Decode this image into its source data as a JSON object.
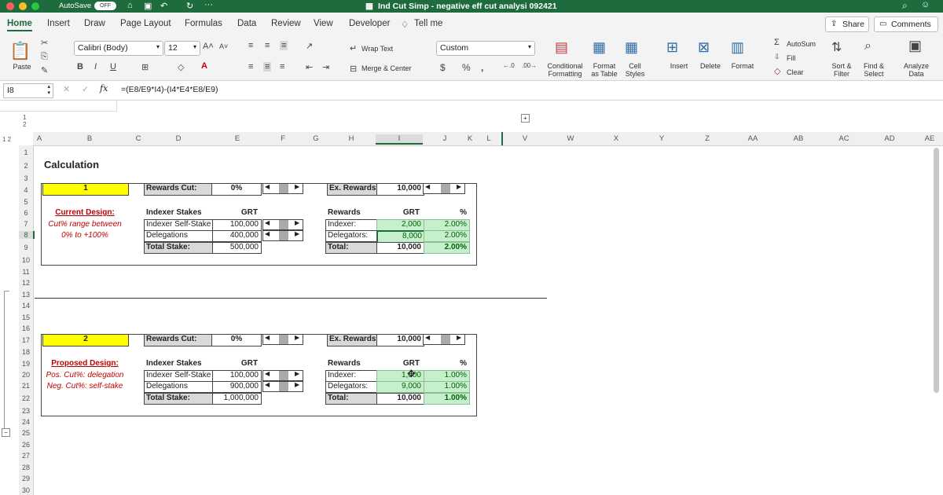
{
  "titlebar": {
    "autosave_label": "AutoSave",
    "autosave_state": "OFF",
    "doc_title": "Ind Cut Simp - negative eff cut analysi 092421"
  },
  "tabs": [
    "Home",
    "Insert",
    "Draw",
    "Page Layout",
    "Formulas",
    "Data",
    "Review",
    "View",
    "Developer"
  ],
  "tell_me": "Tell me",
  "share": "Share",
  "comments": "Comments",
  "ribbon": {
    "paste": "Paste",
    "font_name": "Calibri (Body)",
    "font_size": "12",
    "wrap_text": "Wrap Text",
    "merge_center": "Merge & Center",
    "number_format": "Custom",
    "conditional_formatting": "Conditional Formatting",
    "format_as_table": "Format as Table",
    "cell_styles": "Cell Styles",
    "insert": "Insert",
    "delete": "Delete",
    "format": "Format",
    "autosum": "AutoSum",
    "fill": "Fill",
    "clear": "Clear",
    "sort_filter": "Sort & Filter",
    "find_select": "Find & Select",
    "analyze_data": "Analyze Data"
  },
  "formula_bar": {
    "name_box": "I8",
    "fx": "fx",
    "formula": "=(E8/E9*I4)-(I4*E4*E8/E9)"
  },
  "columns": [
    "A",
    "B",
    "C",
    "D",
    "E",
    "F",
    "G",
    "H",
    "I",
    "J",
    "K",
    "L",
    "V",
    "W",
    "X",
    "Y",
    "Z",
    "AA",
    "AB",
    "AC",
    "AD",
    "AE"
  ],
  "rows": [
    "1",
    "2",
    "3",
    "4",
    "5",
    "6",
    "7",
    "8",
    "9",
    "10",
    "11",
    "12",
    "13",
    "14",
    "15",
    "16",
    "17",
    "18",
    "19",
    "20",
    "21",
    "22",
    "23",
    "24",
    "25",
    "26",
    "27",
    "28",
    "29",
    "30"
  ],
  "sheet": {
    "heading": "Calculation",
    "block1": {
      "id": "1",
      "rewards_cut_label": "Rewards Cut:",
      "rewards_cut_value": "0%",
      "ex_rewards_label": "Ex. Rewards:",
      "ex_rewards_value": "10,000",
      "design_title": "Current Design:",
      "design_line1": "Cut% range between",
      "design_line2": "0% to +100%",
      "stakes_header": "Indexer Stakes",
      "grt_header": "GRT",
      "self_stake_label": "Indexer Self-Stake",
      "self_stake_value": "100,000",
      "delegations_label": "Delegations",
      "delegations_value": "400,000",
      "total_stake_label": "Total Stake:",
      "total_stake_value": "500,000",
      "rewards_header": "Rewards",
      "rewards_grt_header": "GRT",
      "pct_header": "%",
      "indexer_label": "Indexer:",
      "indexer_grt": "2,000",
      "indexer_pct": "2.00%",
      "delegators_label": "Delegators:",
      "delegators_grt": "8,000",
      "delegators_pct": "2.00%",
      "total_label": "Total:",
      "total_grt": "10,000",
      "total_pct": "2.00%"
    },
    "block2": {
      "id": "2",
      "rewards_cut_label": "Rewards Cut:",
      "rewards_cut_value": "0%",
      "ex_rewards_label": "Ex. Rewards:",
      "ex_rewards_value": "10,000",
      "design_title": "Proposed Design:",
      "design_line1": "Pos. Cut%: delegation",
      "design_line2": "Neg. Cut%: self-stake",
      "stakes_header": "Indexer Stakes",
      "grt_header": "GRT",
      "self_stake_label": "Indexer Self-Stake",
      "self_stake_value": "100,000",
      "delegations_label": "Delegations",
      "delegations_value": "900,000",
      "total_stake_label": "Total Stake:",
      "total_stake_value": "1,000,000",
      "rewards_header": "Rewards",
      "rewards_grt_header": "GRT",
      "pct_header": "%",
      "indexer_label": "Indexer:",
      "indexer_grt": "1,000",
      "indexer_pct": "1.00%",
      "delegators_label": "Delegators:",
      "delegators_grt": "9,000",
      "delegators_pct": "1.00%",
      "total_label": "Total:",
      "total_grt": "10,000",
      "total_pct": "1.00%"
    }
  },
  "colors": {
    "excel_green": "#1e6b3d",
    "highlight_yellow": "#ffff00",
    "good_fill": "#c6efce",
    "good_text": "#006100",
    "red_text": "#c00000"
  }
}
